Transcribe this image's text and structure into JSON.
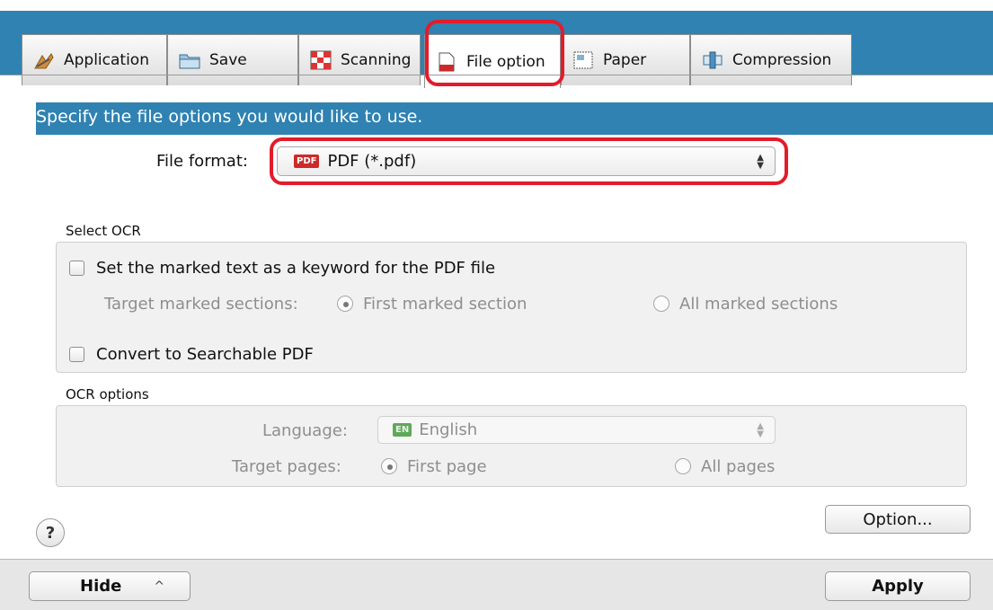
{
  "tabs": [
    {
      "label": "Application",
      "icon": "application-icon"
    },
    {
      "label": "Save",
      "icon": "folder-icon"
    },
    {
      "label": "Scanning",
      "icon": "scanning-icon"
    },
    {
      "label": "File option",
      "icon": "file-icon"
    },
    {
      "label": "Paper",
      "icon": "paper-icon"
    },
    {
      "label": "Compression",
      "icon": "compression-icon"
    }
  ],
  "active_tab": "File option",
  "header": {
    "text": "Specify the file options you would like to use."
  },
  "file_format": {
    "label": "File format:",
    "value": "PDF (*.pdf)",
    "badge": "PDF"
  },
  "select_ocr": {
    "title": "Select OCR",
    "keyword_checkbox": {
      "label": "Set the marked text as a keyword for the PDF file",
      "checked": false
    },
    "target_sections_label": "Target marked sections:",
    "first_marked": "First marked section",
    "all_marked": "All marked sections",
    "searchable_checkbox": {
      "label": "Convert to Searchable PDF",
      "checked": false
    }
  },
  "ocr_options": {
    "title": "OCR options",
    "language_label": "Language:",
    "language_value": "English",
    "language_badge": "EN",
    "target_pages_label": "Target pages:",
    "first_page": "First page",
    "all_pages": "All pages"
  },
  "buttons": {
    "option": "Option...",
    "help": "?",
    "hide": "Hide",
    "hide_caret": "^",
    "apply": "Apply"
  },
  "colors": {
    "accent": "#2f82b1",
    "highlight": "#e21c2b",
    "pdf_badge": "#cc2b2b",
    "en_badge": "#5fa85a"
  }
}
